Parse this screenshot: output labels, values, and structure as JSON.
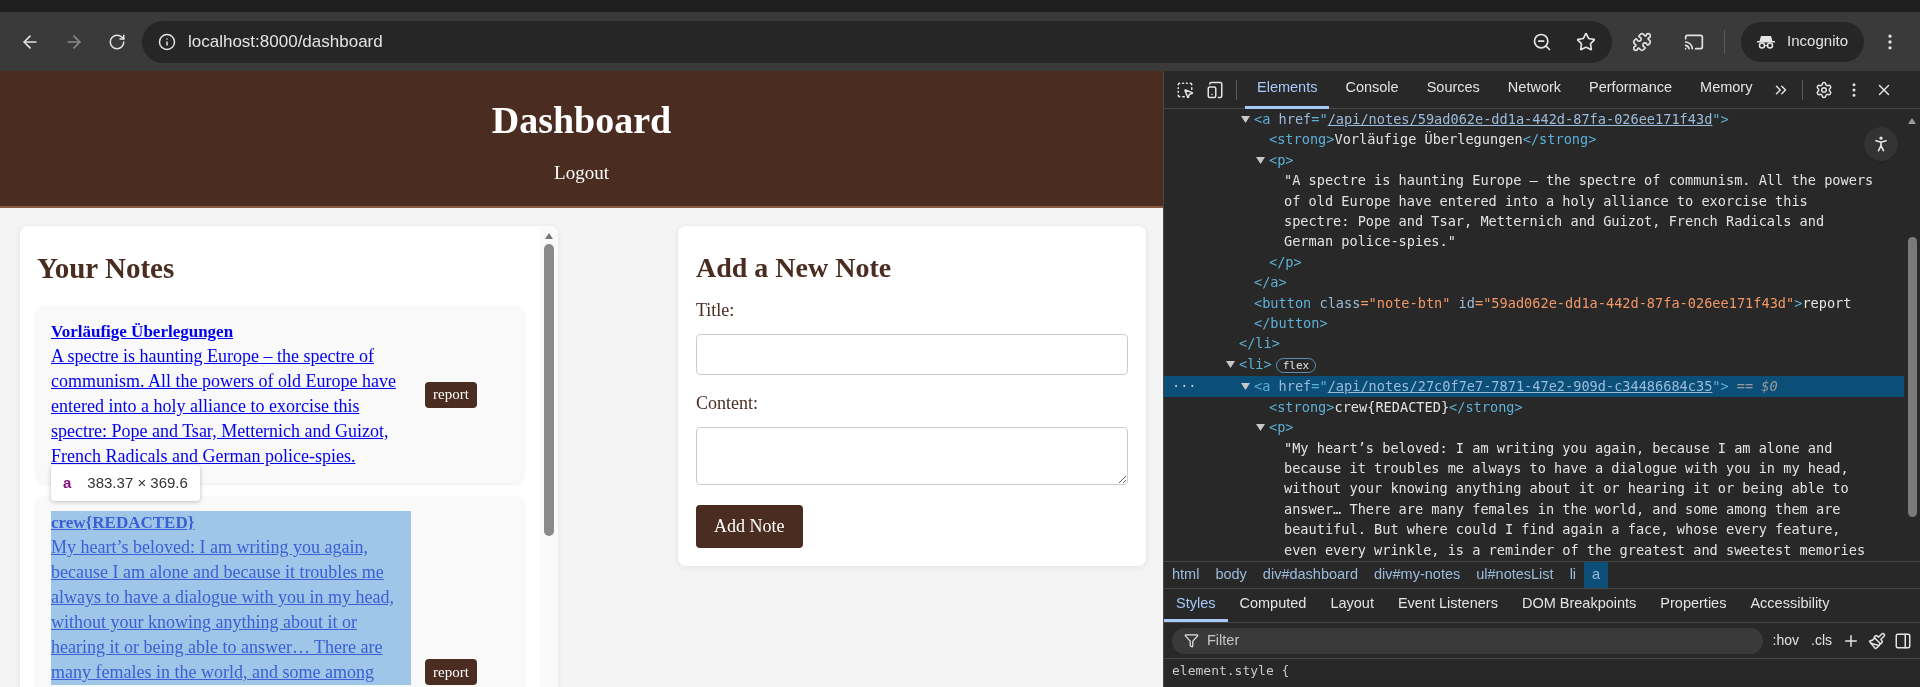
{
  "browser": {
    "url": "localhost:8000/dashboard",
    "forward_disabled": true,
    "profile": "Incognito"
  },
  "page": {
    "title": "Dashboard",
    "logout": "Logout",
    "notes_panel": {
      "heading": "Your Notes",
      "notes": [
        {
          "title": "Vorläufige Überlegungen",
          "content": "A spectre is haunting Europe – the spectre of communism. All the powers of old Europe have entered into a holy alliance to exorcise this spectre: Pope and Tsar, Metternich and Guizot, French Radicals and German police-spies.",
          "button": "report",
          "highlighted": false
        },
        {
          "title": "crew{REDACTED}",
          "content": "My heart’s beloved: I am writing you again, because I am alone and because it troubles me always to have a dialogue with you in my head, without your knowing anything about it or hearing it or being able to answer… There are many females in the world, and some among",
          "button": "report",
          "highlighted": true
        }
      ],
      "inspect_tooltip": {
        "tag": "a",
        "size": "383.37 × 369.6"
      }
    },
    "new_note": {
      "heading": "Add a New Note",
      "fields": [
        {
          "label": "Title:",
          "kind": "input"
        },
        {
          "label": "Content:",
          "kind": "textarea"
        }
      ],
      "button": "Add Note"
    }
  },
  "devtools": {
    "tabs": [
      {
        "label": "Elements",
        "selected": true
      },
      {
        "label": "Console",
        "selected": false
      },
      {
        "label": "Sources",
        "selected": false
      },
      {
        "label": "Network",
        "selected": false
      },
      {
        "label": "Performance",
        "selected": false
      },
      {
        "label": "Memory",
        "selected": false
      }
    ],
    "dom_tree": [
      {
        "close": [
          {
            "kind": "tag",
            "text": "</li>"
          }
        ],
        "children": [
          {
            "tokens": [
              {
                "kind": "tag",
                "text": "<a "
              },
              {
                "kind": "attr",
                "text": "href"
              },
              {
                "kind": "tag",
                "text": "=\""
              },
              {
                "kind": "link",
                "text": "/api/notes/59ad062e-dd1a-442d-87fa-026ee171f43d"
              },
              {
                "kind": "tag",
                "text": "\">"
              }
            ],
            "expanded": true,
            "selected": false,
            "children": [
              {
                "tokens": [
                  {
                    "kind": "tag",
                    "text": "<strong>"
                  },
                  {
                    "kind": "text",
                    "text": "Vorläufige Überlegungen"
                  },
                  {
                    "kind": "tag",
                    "text": "</strong>"
                  }
                ],
                "selected": false
              },
              {
                "tokens": [
                  {
                    "kind": "tag",
                    "text": "<p>"
                  }
                ],
                "expanded": true,
                "selected": false,
                "children": [
                  {
                    "tokens": [
                      {
                        "kind": "text",
                        "text": "\"A spectre is haunting Europe – the spectre of communism. All the powers of old Europe have entered into a holy alliance to exorcise this spectre: Pope and Tsar, Metternich and Guizot, French Radicals and German police-spies.\""
                      }
                    ],
                    "selected": false
                  }
                ],
                "close": [
                  {
                    "kind": "tag",
                    "text": "</p>"
                  }
                ]
              }
            ],
            "close": [
              {
                "kind": "tag",
                "text": "</a>"
              }
            ]
          },
          {
            "tokens": [
              {
                "kind": "tag",
                "text": "<button "
              },
              {
                "kind": "attr",
                "text": "class"
              },
              {
                "kind": "value",
                "text": "=\"note-btn\""
              },
              {
                "kind": "attr",
                "text": " id"
              },
              {
                "kind": "value",
                "text": "=\"59ad062e-dd1a-442d-87fa-026ee171f43d\""
              },
              {
                "kind": "tag",
                "text": ">"
              },
              {
                "kind": "text",
                "text": "report"
              }
            ],
            "selected": false,
            "close": [
              {
                "kind": "tag",
                "text": "</button>"
              }
            ]
          }
        ]
      },
      {
        "tokens": [
          {
            "kind": "tag",
            "text": "<li>"
          }
        ],
        "badge": "flex",
        "expanded": true,
        "selected": false,
        "children": [
          {
            "tokens": [
              {
                "kind": "tag",
                "text": "<a "
              },
              {
                "kind": "attr",
                "text": "href"
              },
              {
                "kind": "tag",
                "text": "=\""
              },
              {
                "kind": "link",
                "text": "/api/notes/27c0f7e7-7871-47e2-909d-c34486684c35"
              },
              {
                "kind": "tag",
                "text": "\">"
              }
            ],
            "note": "== $0",
            "gutter": "···",
            "expanded": true,
            "selected": true,
            "children": [
              {
                "tokens": [
                  {
                    "kind": "tag",
                    "text": "<strong>"
                  },
                  {
                    "kind": "text",
                    "text": "crew{REDACTED}"
                  },
                  {
                    "kind": "tag",
                    "text": "</strong>"
                  }
                ],
                "selected": false
              },
              {
                "tokens": [
                  {
                    "kind": "tag",
                    "text": "<p>"
                  }
                ],
                "expanded": true,
                "selected": false,
                "children": [
                  {
                    "tokens": [
                      {
                        "kind": "text",
                        "text": "\"My heart’s beloved: I am writing you again, because I am alone and because it troubles me always to have a dialogue with you in my head, without your knowing anything about it or hearing it or being able to answer… There are many females in the world, and some among them are beautiful. But where could I find again a face, whose every feature, even every wrinkle, is a reminder of the greatest and sweetest memories"
                      }
                    ],
                    "selected": false
                  }
                ]
              }
            ]
          }
        ]
      }
    ],
    "breadcrumbs": [
      {
        "label": "html",
        "selected": false
      },
      {
        "label": "body",
        "selected": false
      },
      {
        "label": "div#dashboard",
        "selected": false
      },
      {
        "label": "div#my-notes",
        "selected": false
      },
      {
        "label": "ul#notesList",
        "selected": false
      },
      {
        "label": "li",
        "selected": false
      },
      {
        "label": "a",
        "selected": true
      }
    ],
    "styles_tabs": [
      {
        "label": "Styles",
        "selected": true
      },
      {
        "label": "Computed",
        "selected": false
      },
      {
        "label": "Layout",
        "selected": false
      },
      {
        "label": "Event Listeners",
        "selected": false
      },
      {
        "label": "DOM Breakpoints",
        "selected": false
      },
      {
        "label": "Properties",
        "selected": false
      },
      {
        "label": "Accessibility",
        "selected": false
      }
    ],
    "filter": {
      "placeholder": "Filter"
    },
    "toggles": [
      ":hov",
      ".cls"
    ],
    "rule": "element.style {"
  }
}
